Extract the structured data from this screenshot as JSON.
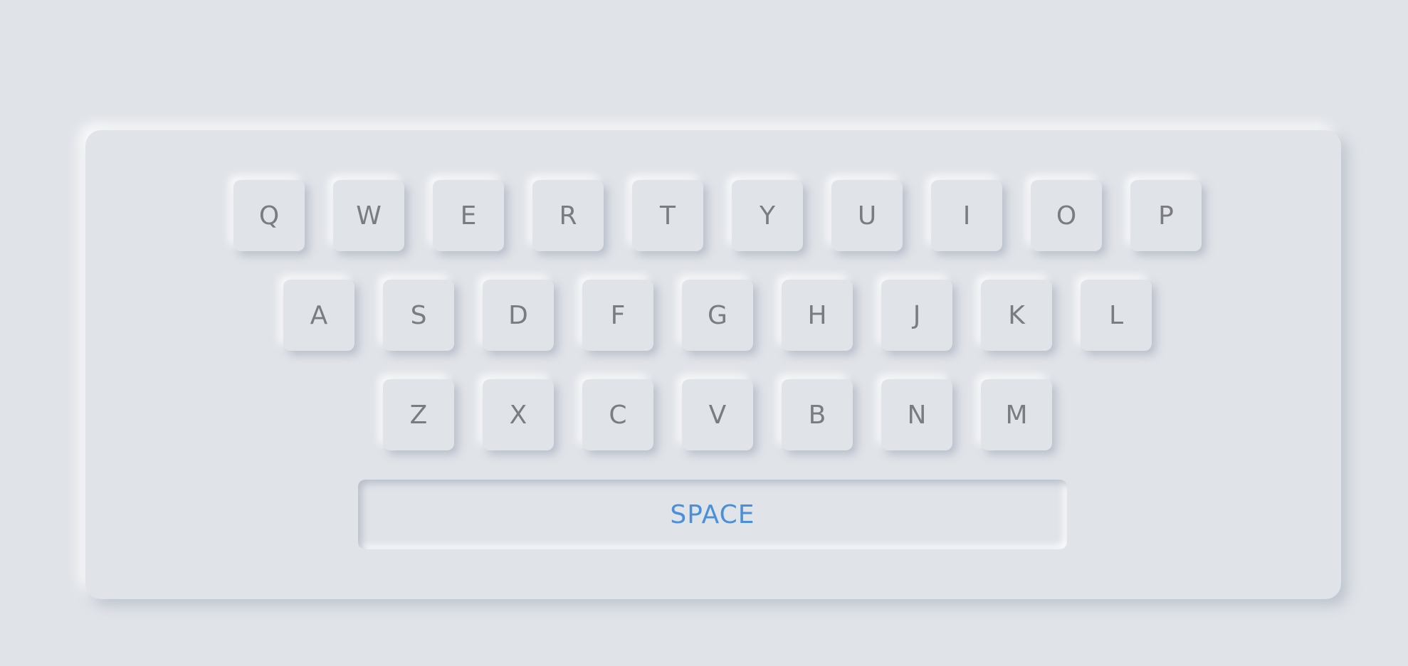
{
  "colors": {
    "background": "#e0e3e8",
    "key_text": "#7a7c80",
    "accent": "#4a90d9"
  },
  "keyboard": {
    "rows": [
      [
        "Q",
        "W",
        "E",
        "R",
        "T",
        "Y",
        "U",
        "I",
        "O",
        "P"
      ],
      [
        "A",
        "S",
        "D",
        "F",
        "G",
        "H",
        "J",
        "K",
        "L"
      ],
      [
        "Z",
        "X",
        "C",
        "V",
        "B",
        "N",
        "M"
      ]
    ],
    "space_label": "SPACE"
  }
}
